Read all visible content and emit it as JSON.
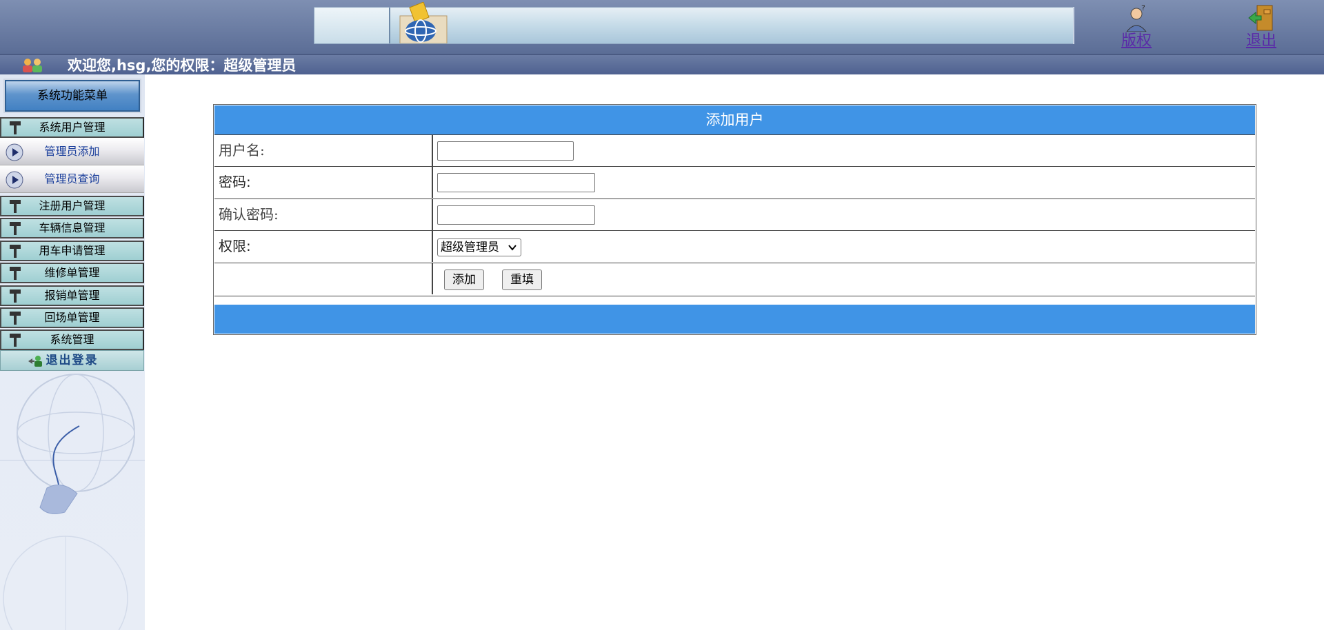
{
  "header": {
    "copyright_label": "版权",
    "exit_label": "退出"
  },
  "welcome": {
    "text": "欢迎您,hsg,您的权限：超级管理员"
  },
  "sidebar": {
    "title": "系统功能菜单",
    "groups": [
      {
        "label": "系统用户管理"
      },
      {
        "label": "注册用户管理"
      },
      {
        "label": "车辆信息管理"
      },
      {
        "label": "用车申请管理"
      },
      {
        "label": "维修单管理"
      },
      {
        "label": "报销单管理"
      },
      {
        "label": "回场单管理"
      },
      {
        "label": "系统管理"
      }
    ],
    "sub_items": [
      {
        "label": "管理员添加"
      },
      {
        "label": "管理员查询"
      }
    ],
    "logout_label": "退出登录"
  },
  "form": {
    "title": "添加用户",
    "username_label": "用户名:",
    "username_value": "",
    "password_label": "密码:",
    "password_value": "",
    "confirm_label": "确认密码:",
    "confirm_value": "",
    "permission_label": "权限:",
    "permission_selected": "超级管理员",
    "add_button": "添加",
    "reset_button": "重填"
  },
  "colors": {
    "header_blue": "#4094e6",
    "topbar": "#6b7ca4",
    "menu_group": "#a7d2d5",
    "link_purple": "#5a2aa8"
  }
}
